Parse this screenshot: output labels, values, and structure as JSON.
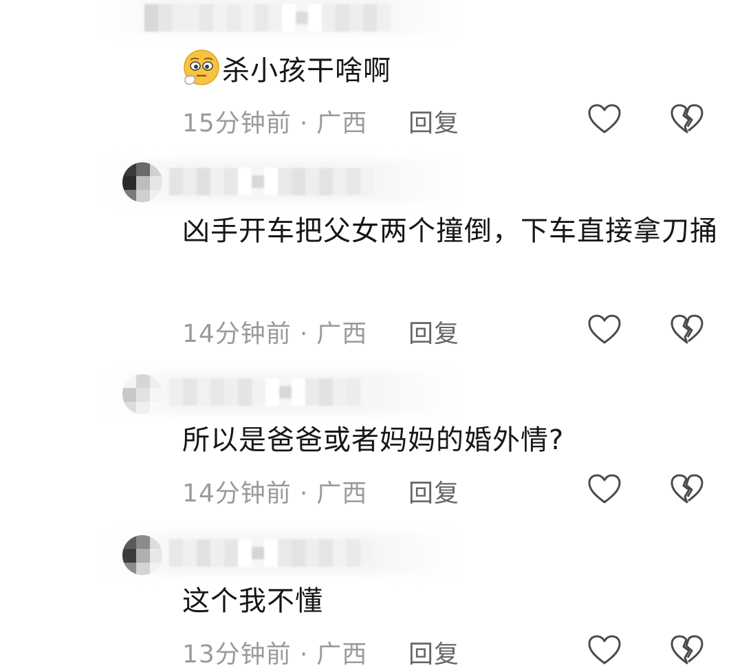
{
  "comments": [
    {
      "text": "杀小孩干啥啊",
      "emoji": "pleading-face-emoji",
      "time": "15分钟前",
      "separator": "·",
      "location": "广西",
      "reply_label": "回复"
    },
    {
      "text": "凶手开车把父女两个撞倒，下车直接拿刀捅",
      "time": "14分钟前",
      "separator": "·",
      "location": "广西",
      "reply_label": "回复"
    },
    {
      "text": "所以是爸爸或者妈妈的婚外情?",
      "time": "14分钟前",
      "separator": "·",
      "location": "广西",
      "reply_label": "回复"
    },
    {
      "text": "这个我不懂",
      "time": "13分钟前",
      "separator": "·",
      "location": "广西",
      "reply_label": "回复"
    }
  ],
  "icons": {
    "like": "heart-outline-icon",
    "dislike": "broken-heart-outline-icon"
  },
  "colors": {
    "text": "#161616",
    "meta": "#9a9a9a",
    "reply": "#666666",
    "icon": "#4a4a4a"
  }
}
